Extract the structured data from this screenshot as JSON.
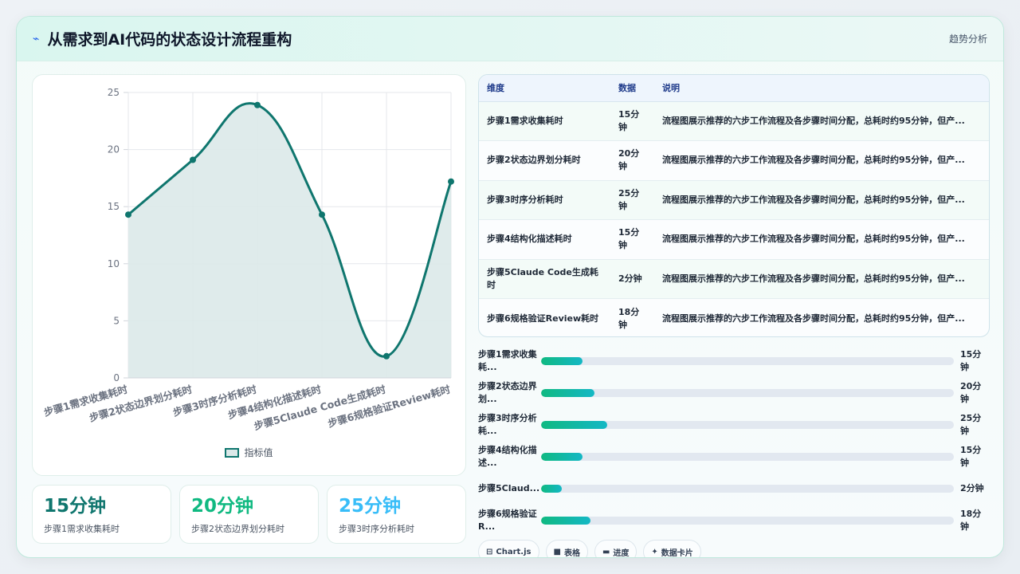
{
  "header": {
    "icon": "lightning-icon",
    "title": "从需求到AI代码的状态设计流程重构",
    "right_label": "趋势分析"
  },
  "chart_data": {
    "type": "area",
    "categories": [
      "步骤1需求收集耗时",
      "步骤2状态边界划分耗时",
      "步骤3时序分析耗时",
      "步骤4结构化描述耗时",
      "步骤5Claude Code生成耗时",
      "步骤6规格验证Review耗时"
    ],
    "series": [
      {
        "name": "指标值",
        "values": [
          14.3,
          19.1,
          23.9,
          14.3,
          1.9,
          17.2
        ]
      }
    ],
    "ylim": [
      0,
      25
    ],
    "yticks": [
      "0",
      "5",
      "10",
      "15",
      "20",
      "25"
    ],
    "grid": true,
    "legend": "bottom",
    "colors": {
      "line": "#0f766e",
      "fill": "#dbe9e9"
    }
  },
  "kpis": [
    {
      "value": "15分钟",
      "label": "步骤1需求收集耗时",
      "color": "#0f766e"
    },
    {
      "value": "20分钟",
      "label": "步骤2状态边界划分耗时",
      "color": "#10b981"
    },
    {
      "value": "25分钟",
      "label": "步骤3时序分析耗时",
      "color": "#38bdf8"
    }
  ],
  "table": {
    "headers": [
      "维度",
      "数据",
      "说明"
    ],
    "rows": [
      [
        "步骤1需求收集耗时",
        "15分钟",
        "流程图展示推荐的六步工作流程及各步骤时间分配，总耗时约95分钟，但产..."
      ],
      [
        "步骤2状态边界划分耗时",
        "20分钟",
        "流程图展示推荐的六步工作流程及各步骤时间分配，总耗时约95分钟，但产..."
      ],
      [
        "步骤3时序分析耗时",
        "25分钟",
        "流程图展示推荐的六步工作流程及各步骤时间分配，总耗时约95分钟，但产..."
      ],
      [
        "步骤4结构化描述耗时",
        "15分钟",
        "流程图展示推荐的六步工作流程及各步骤时间分配，总耗时约95分钟，但产..."
      ],
      [
        "步骤5Claude Code生成耗时",
        "2分钟",
        "流程图展示推荐的六步工作流程及各步骤时间分配，总耗时约95分钟，但产..."
      ],
      [
        "步骤6规格验证Review耗时",
        "18分钟",
        "流程图展示推荐的六步工作流程及各步骤时间分配，总耗时约95分钟，但产..."
      ]
    ]
  },
  "progress": [
    {
      "label": "步骤1需求收集耗...",
      "value": "15分钟",
      "fraction": 0.1
    },
    {
      "label": "步骤2状态边界划...",
      "value": "20分钟",
      "fraction": 0.13
    },
    {
      "label": "步骤3时序分析耗...",
      "value": "25分钟",
      "fraction": 0.16
    },
    {
      "label": "步骤4结构化描述...",
      "value": "15分钟",
      "fraction": 0.1
    },
    {
      "label": "步骤5Claud...",
      "value": "2分钟",
      "fraction": 0.05
    },
    {
      "label": "步骤6规格验证R...",
      "value": "18分钟",
      "fraction": 0.12
    }
  ],
  "tags": [
    {
      "icon": "chart-icon",
      "glyph": "⊟",
      "label": "Chart.js"
    },
    {
      "icon": "table-icon",
      "glyph": "■",
      "label": "表格"
    },
    {
      "icon": "progress-icon",
      "glyph": "▬",
      "label": "进度"
    },
    {
      "icon": "sparkle-icon",
      "glyph": "✦",
      "label": "数据卡片"
    }
  ]
}
